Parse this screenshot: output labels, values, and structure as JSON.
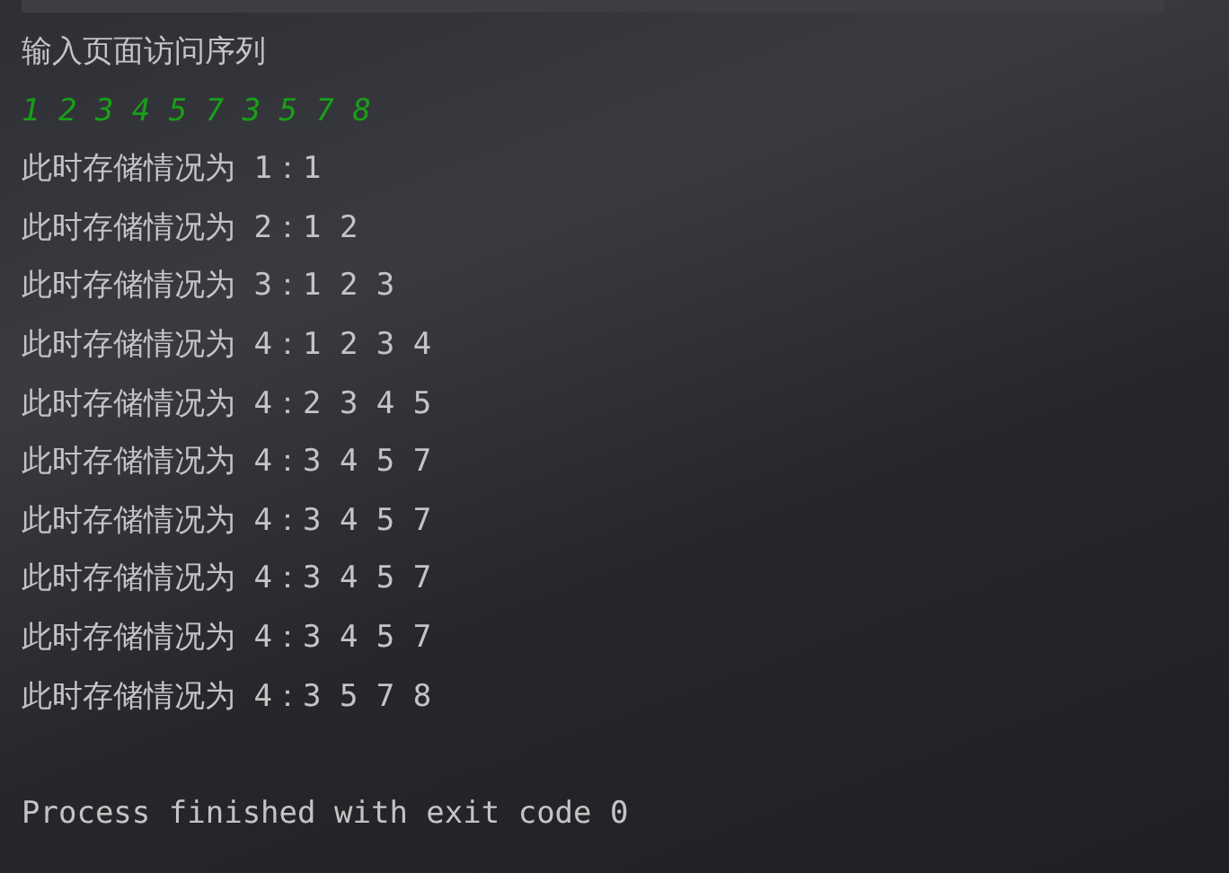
{
  "console": {
    "lines": [
      {
        "kind": "output",
        "text": "输入页面访问序列"
      },
      {
        "kind": "input",
        "text": "1 2 3 4 5 7 3 5 7 8"
      },
      {
        "kind": "output",
        "text": "此时存储情况为 1：1"
      },
      {
        "kind": "output",
        "text": "此时存储情况为 2：1 2"
      },
      {
        "kind": "output",
        "text": "此时存储情况为 3：1 2 3"
      },
      {
        "kind": "output",
        "text": "此时存储情况为 4：1 2 3 4"
      },
      {
        "kind": "output",
        "text": "此时存储情况为 4：2 3 4 5"
      },
      {
        "kind": "output",
        "text": "此时存储情况为 4：3 4 5 7"
      },
      {
        "kind": "output",
        "text": "此时存储情况为 4：3 4 5 7"
      },
      {
        "kind": "output",
        "text": "此时存储情况为 4：3 4 5 7"
      },
      {
        "kind": "output",
        "text": "此时存储情况为 4：3 4 5 7"
      },
      {
        "kind": "output",
        "text": "此时存储情况为 4：3 5 7 8"
      },
      {
        "kind": "blank"
      },
      {
        "kind": "output",
        "text": "Process finished with exit code 0"
      }
    ]
  }
}
